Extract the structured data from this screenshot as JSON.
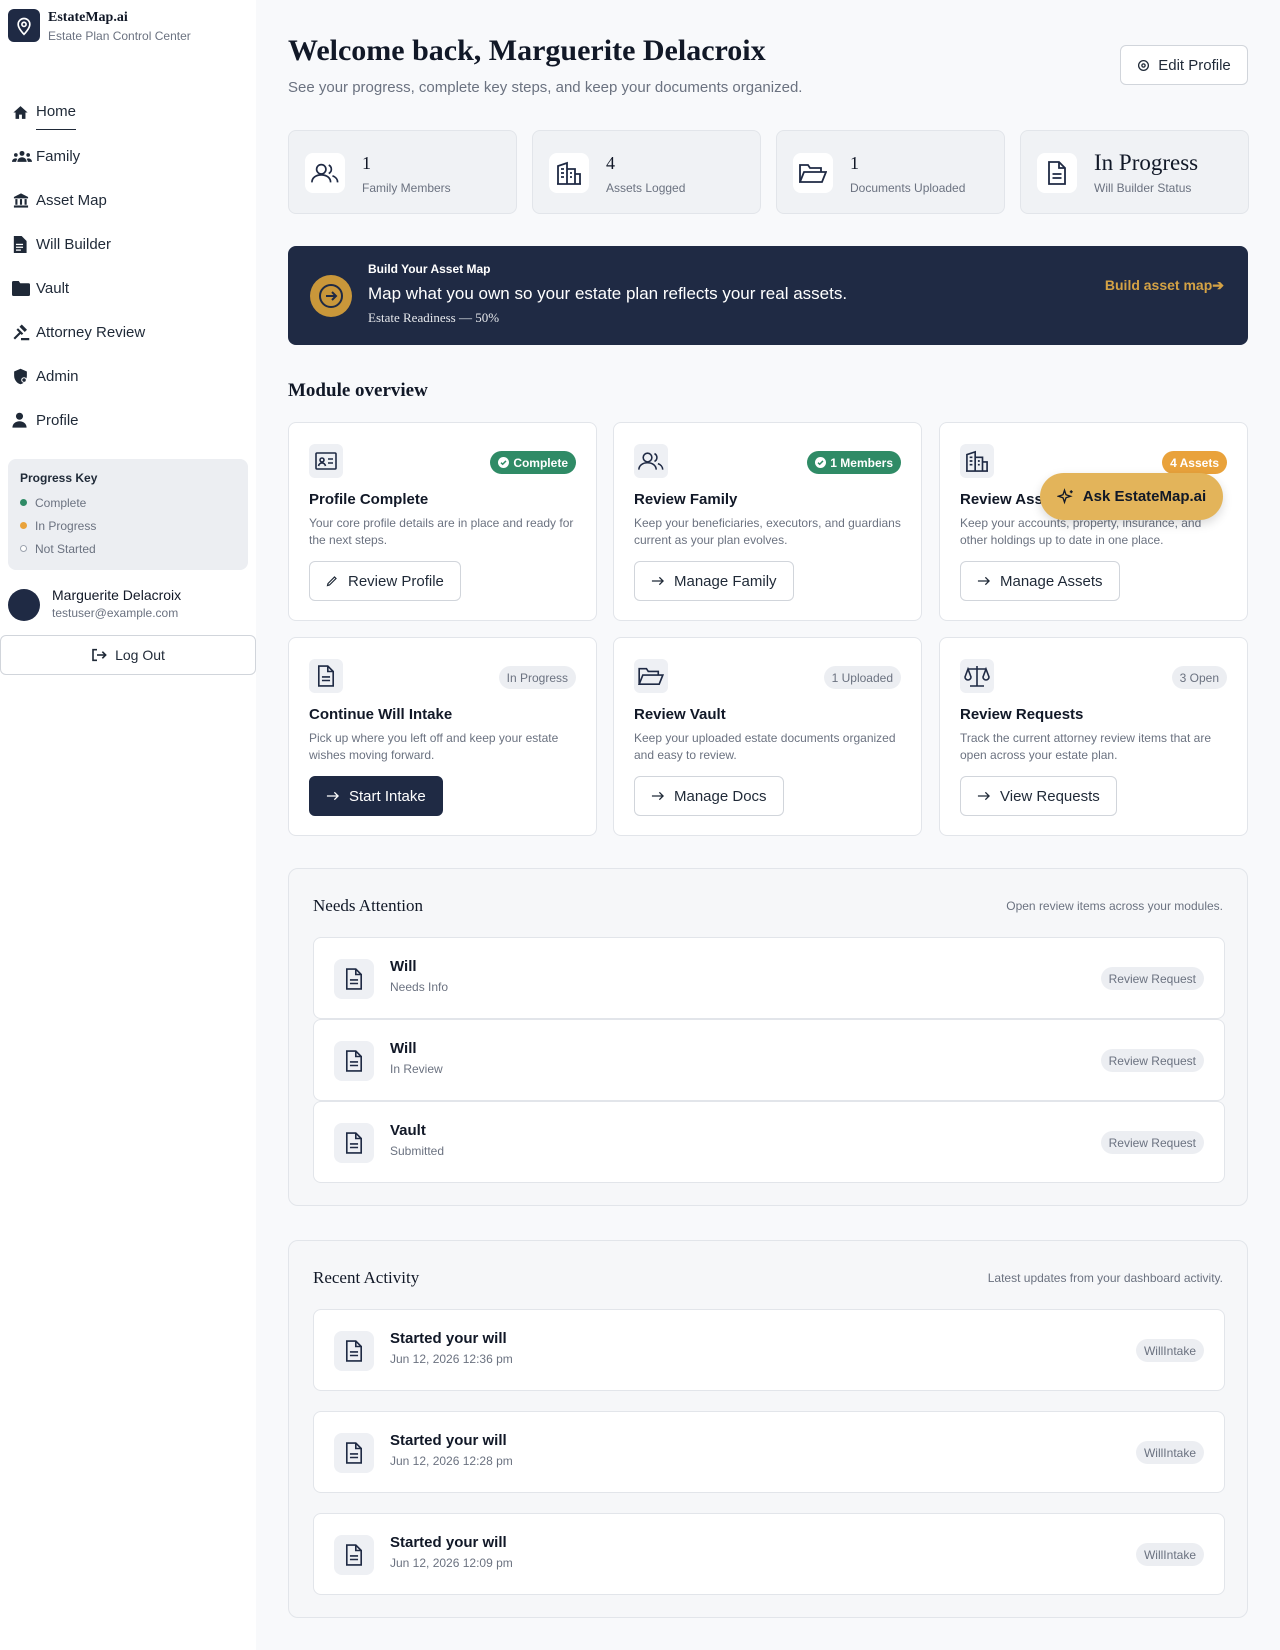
{
  "brand": {
    "name": "EstateMap.ai",
    "subtitle": "Estate Plan Control Center"
  },
  "nav": {
    "items": [
      {
        "label": "Home",
        "icon": "home-icon"
      },
      {
        "label": "Family",
        "icon": "family-icon"
      },
      {
        "label": "Asset Map",
        "icon": "bank-icon"
      },
      {
        "label": "Will Builder",
        "icon": "document-icon"
      },
      {
        "label": "Vault",
        "icon": "folder-icon"
      },
      {
        "label": "Attorney Review",
        "icon": "gavel-icon"
      },
      {
        "label": "Admin",
        "icon": "shield-icon"
      },
      {
        "label": "Profile",
        "icon": "user-icon"
      }
    ]
  },
  "progress_key": {
    "title": "Progress Key",
    "items": [
      {
        "label": "Complete",
        "color": "#2f8b66"
      },
      {
        "label": "In Progress",
        "color": "#e9a23b"
      },
      {
        "label": "Not Started",
        "color": "#ffffff"
      }
    ]
  },
  "user": {
    "name": "Marguerite Delacroix",
    "email": "testuser@example.com",
    "logout_label": "Log Out"
  },
  "header": {
    "title": "Welcome back, Marguerite Delacroix",
    "subtitle": "See your progress, complete key steps, and keep your documents organized.",
    "edit_label": "Edit Profile"
  },
  "stats": [
    {
      "value": "1",
      "label": "Family Members",
      "icon": "users-icon"
    },
    {
      "value": "4",
      "label": "Assets Logged",
      "icon": "building-icon"
    },
    {
      "value": "1",
      "label": "Documents Uploaded",
      "icon": "folder-open-icon"
    },
    {
      "value": "In Progress",
      "label": "Will Builder Status",
      "icon": "document-icon"
    }
  ],
  "banner": {
    "eyebrow": "Build Your Asset Map",
    "title": "Map what you own so your estate plan reflects your real assets.",
    "subtitle": "Estate Readiness — 50%",
    "link": "Build asset map"
  },
  "modules_title": "Module overview",
  "modules": [
    {
      "title": "Profile Complete",
      "desc": "Your core profile details are in place and ready for the next steps.",
      "badge": "Complete",
      "button": "Review Profile"
    },
    {
      "title": "Review Family",
      "desc": "Keep your beneficiaries, executors, and guardians current as your plan evolves.",
      "badge": "1 Members",
      "button": "Manage Family"
    },
    {
      "title": "Review Assets",
      "desc": "Keep your accounts, property, insurance, and other holdings up to date in one place.",
      "badge": "4 Assets",
      "button": "Manage Assets"
    },
    {
      "title": "Continue Will Intake",
      "desc": "Pick up where you left off and keep your estate wishes moving forward.",
      "badge": "In Progress",
      "button": "Start Intake"
    },
    {
      "title": "Review Vault",
      "desc": "Keep your uploaded estate documents organized and easy to review.",
      "badge": "1 Uploaded",
      "button": "Manage Docs"
    },
    {
      "title": "Review Requests",
      "desc": "Track the current attorney review items that are open across your estate plan.",
      "badge": "3 Open",
      "button": "View Requests"
    }
  ],
  "ask_label": "Ask EstateMap.ai",
  "attention": {
    "title": "Needs Attention",
    "subtitle": "Open review items across your modules.",
    "items": [
      {
        "title": "Will",
        "status": "Needs Info",
        "tag": "Review Request"
      },
      {
        "title": "Will",
        "status": "In Review",
        "tag": "Review Request"
      },
      {
        "title": "Vault",
        "status": "Submitted",
        "tag": "Review Request"
      }
    ]
  },
  "activity": {
    "title": "Recent Activity",
    "subtitle": "Latest updates from your dashboard activity.",
    "items": [
      {
        "title": "Started your will",
        "time": "Jun 12, 2026 12:36 pm",
        "tag": "WillIntake"
      },
      {
        "title": "Started your will",
        "time": "Jun 12, 2026 12:28 pm",
        "tag": "WillIntake"
      },
      {
        "title": "Started your will",
        "time": "Jun 12, 2026 12:09 pm",
        "tag": "WillIntake"
      }
    ]
  }
}
